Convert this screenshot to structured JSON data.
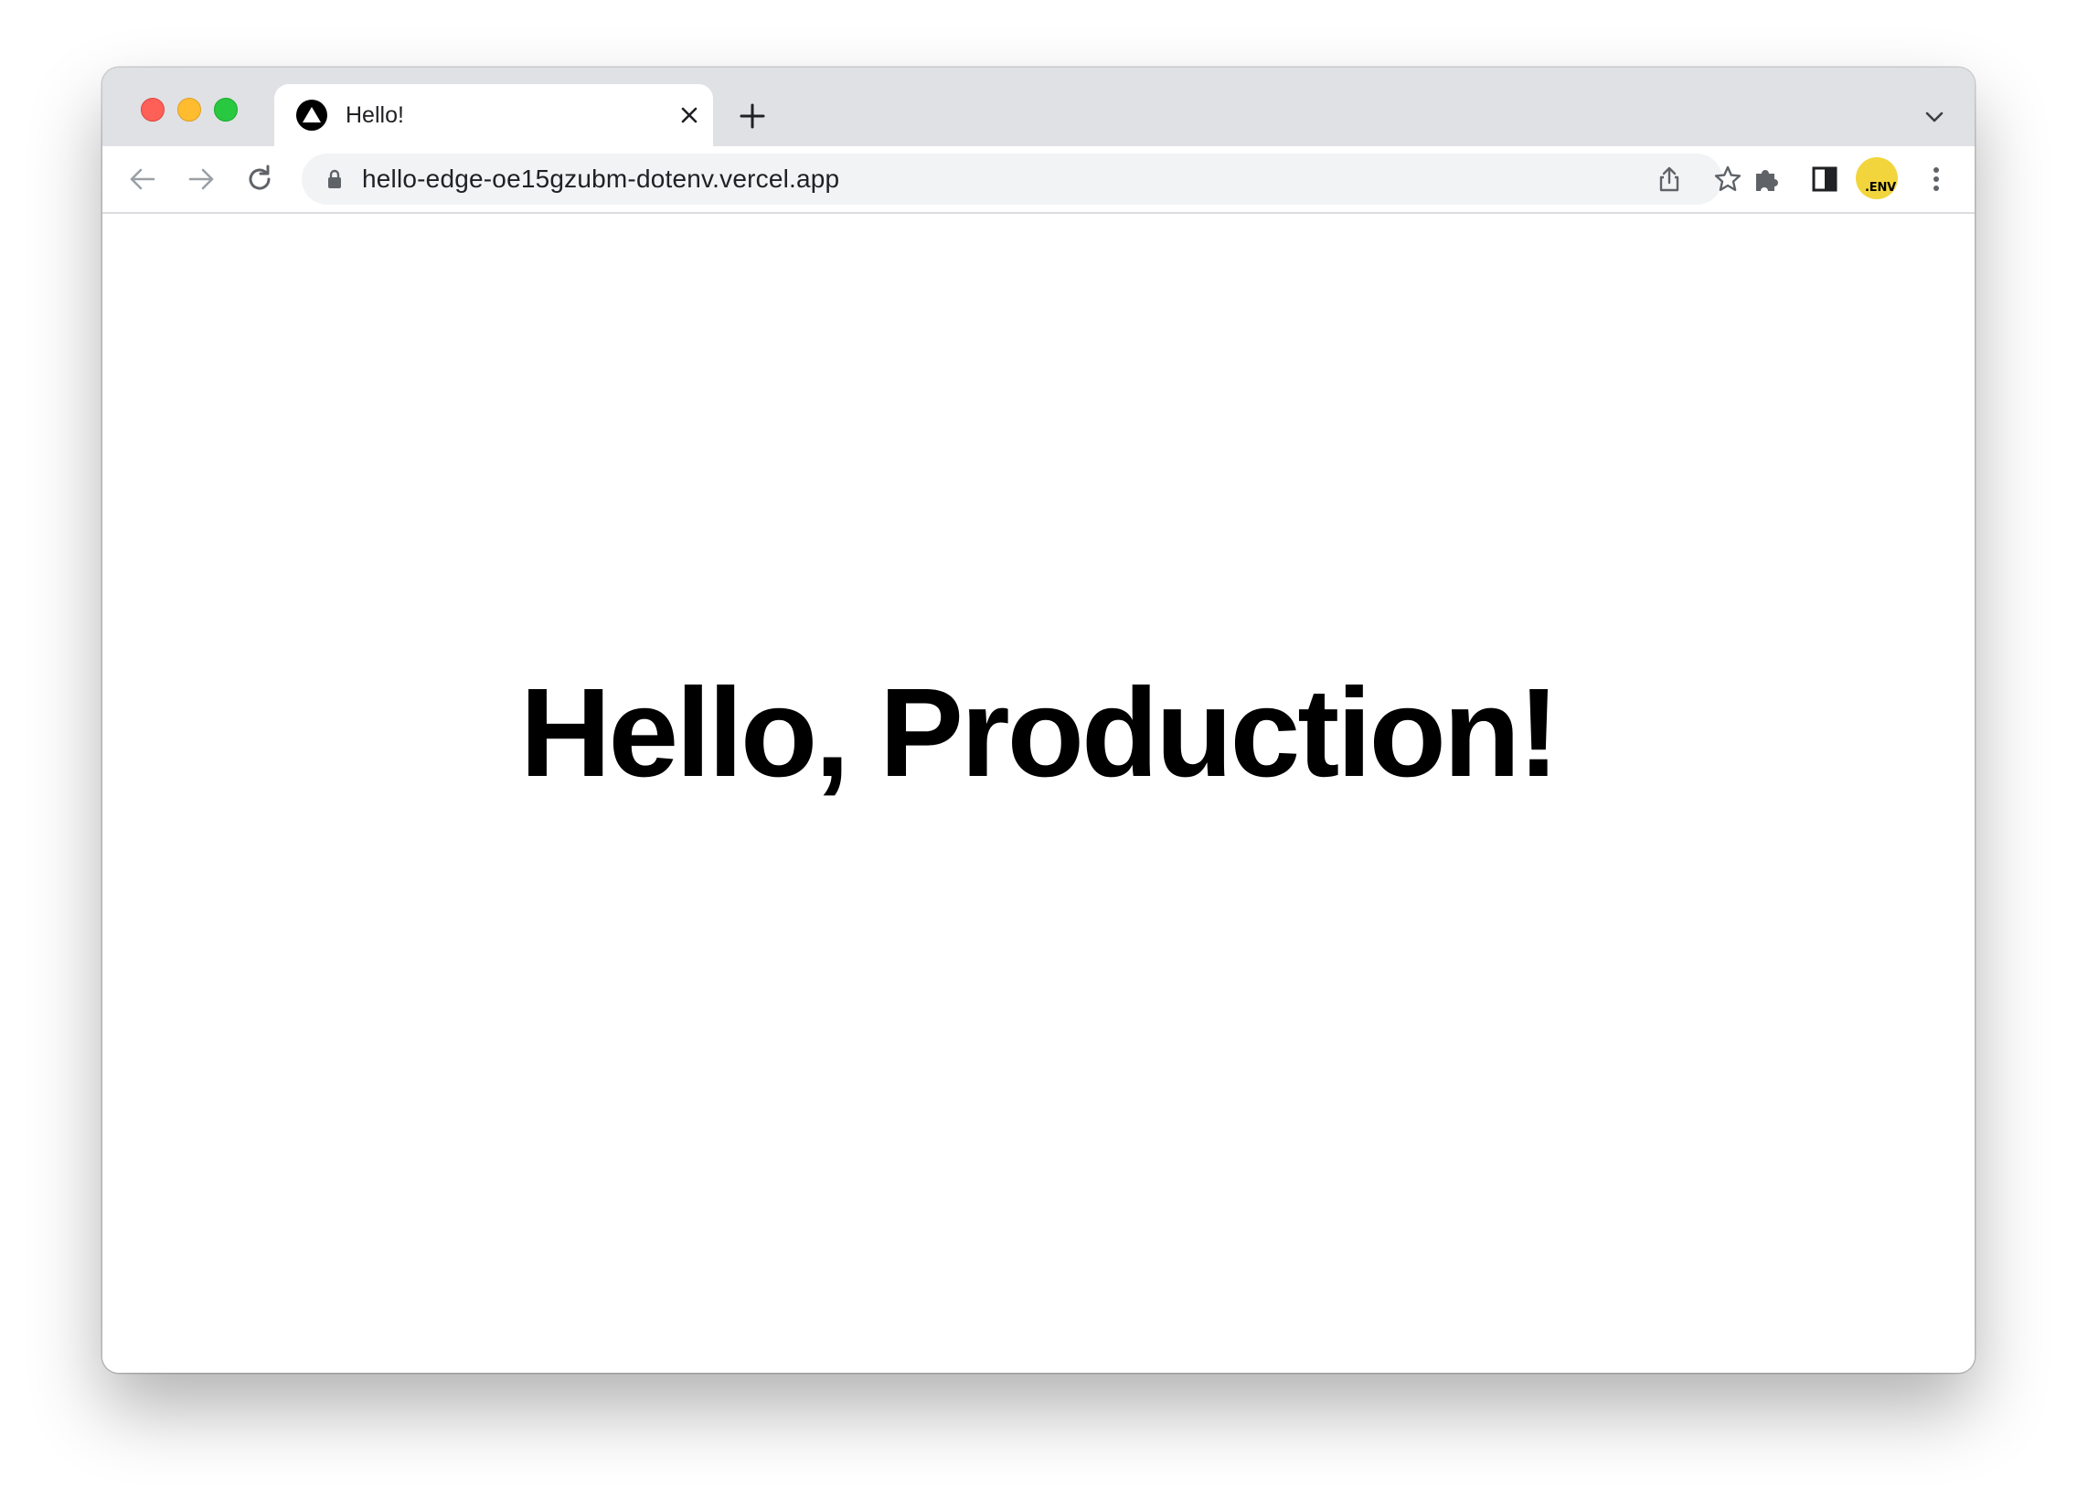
{
  "tab": {
    "title": "Hello!",
    "favicon": "vercel-triangle-icon"
  },
  "toolbar": {
    "url": "hello-edge-oe15gzubm-dotenv.vercel.app",
    "avatar_label": ".ENV"
  },
  "page": {
    "heading": "Hello, Production!"
  },
  "colors": {
    "tabstrip": "#dfe1e5",
    "omnibox": "#f1f3f4",
    "avatar": "#f2d53c",
    "traffic_red": "#fe5f57",
    "traffic_yellow": "#febc2e",
    "traffic_green": "#28c840"
  }
}
